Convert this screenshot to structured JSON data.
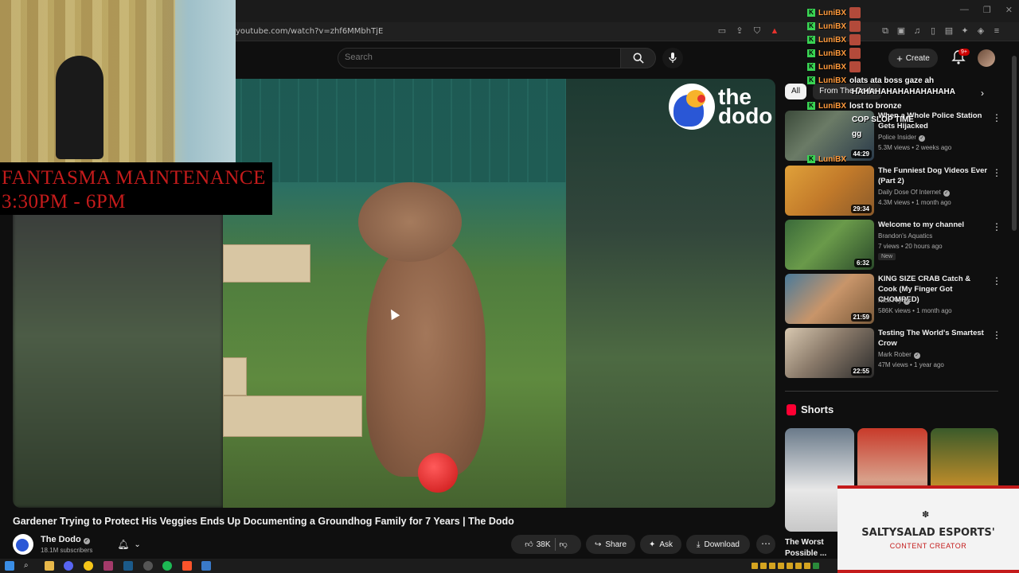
{
  "browser": {
    "url": "youtube.com/watch?v=zhf6MMbhTjE"
  },
  "header": {
    "search_placeholder": "Search",
    "create_label": "Create",
    "notif_badge": "9+"
  },
  "overlay": {
    "maintenance_line1": "FANTASMA MAINTENANCE",
    "maintenance_line2": "3:30PM - 6PM",
    "salty_title": "SALTYSALAD ESPORTS'",
    "salty_sub": "CONTENT CREATOR"
  },
  "chat": [
    {
      "user": "LuniBX",
      "msg": ""
    },
    {
      "user": "LuniBX",
      "msg": ""
    },
    {
      "user": "LuniBX",
      "msg": ""
    },
    {
      "user": "LuniBX",
      "msg": ""
    },
    {
      "user": "LuniBX",
      "msg": ""
    },
    {
      "user": "LuniBX",
      "msg": "olats ata boss gaze ah"
    },
    {
      "user": "",
      "msg": "HAHAHAHAHAHAHAHAHA"
    },
    {
      "user": "LuniBX",
      "msg": "lost to bronze"
    },
    {
      "user": "",
      "msg": "COP SLOP TIME"
    },
    {
      "user": "",
      "msg": "gg"
    },
    {
      "user": "LuniBX",
      "msg": ""
    }
  ],
  "chips": {
    "items": [
      "All",
      "From The Dodo"
    ]
  },
  "related": [
    {
      "title": "When a Whole Police Station Gets Hijacked",
      "channel": "Police Insider",
      "meta": "5.3M views • 2 weeks ago",
      "duration": "44:29",
      "new": ""
    },
    {
      "title": "The Funniest Dog Videos Ever (Part 2)",
      "channel": "Daily Dose Of Internet",
      "meta": "4.3M views • 1 month ago",
      "duration": "29:34",
      "new": ""
    },
    {
      "title": "Welcome to my channel",
      "channel": "Brandon's Aquatics",
      "meta": "7 views • 20 hours ago",
      "duration": "6:32",
      "new": "New"
    },
    {
      "title": "KING SIZE CRAB Catch & Cook (My Finger Got CHOMPED)",
      "channel": "Nick Fry",
      "meta": "586K views • 1 month ago",
      "duration": "21:59",
      "new": ""
    },
    {
      "title": "Testing The World's Smartest Crow",
      "channel": "Mark Rober",
      "meta": "47M views • 1 year ago",
      "duration": "22:55",
      "new": ""
    }
  ],
  "shorts": {
    "heading": "Shorts",
    "first_title": "The Worst Possible ..."
  },
  "video": {
    "title": "Gardener Trying to Protect His Veggies Ends Up Documenting a Groundhog Family for 7 Years | The Dodo",
    "channel": "The Dodo",
    "subscribers": "18.1M subscribers",
    "likes": "38K",
    "share_label": "Share",
    "ask_label": "Ask",
    "download_label": "Download",
    "logo_text_1": "the",
    "logo_text_2": "dodo"
  },
  "colors": {
    "accent": "#ff0033",
    "maintenance": "#c41b1b",
    "chat_user": "#ff9a3c"
  }
}
